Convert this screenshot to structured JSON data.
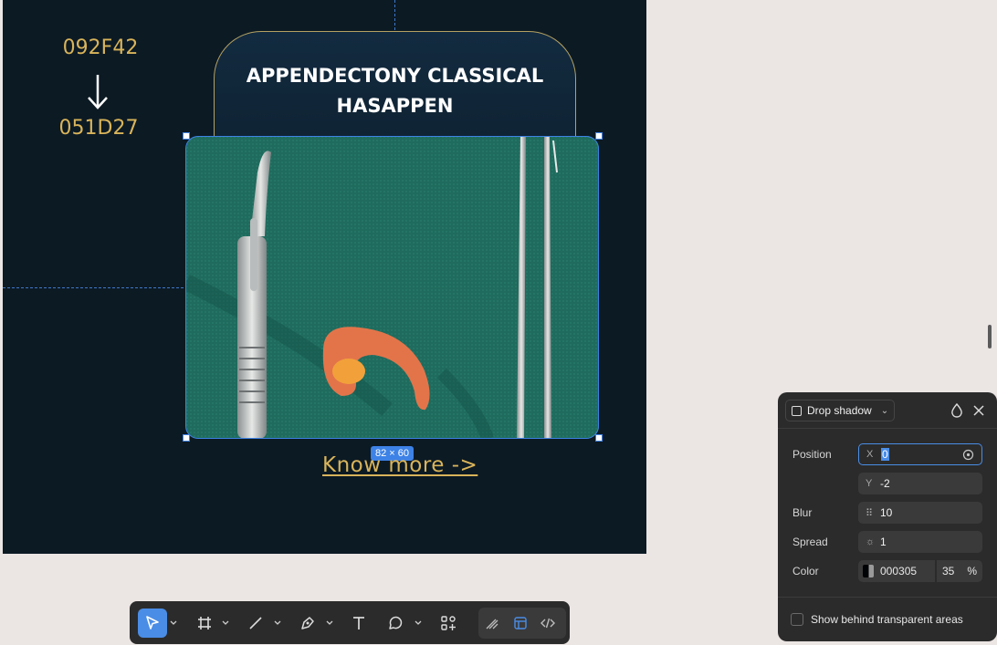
{
  "canvas": {
    "color_from": "092F42",
    "color_to": "051D27",
    "title_lines": [
      "APPENDECTONY CLASSICAL",
      "HASAPPEN"
    ],
    "selection_size": "82 × 60",
    "link_text": "Know more ->",
    "frame_bg": "#0c1a24",
    "accent_gold": "#d9b45a"
  },
  "panel": {
    "type_label": "Drop shadow",
    "icons": [
      "drop-icon",
      "close-icon"
    ],
    "position_label": "Position",
    "x_prefix": "X",
    "x_value": "0",
    "y_prefix": "Y",
    "y_value": "-2",
    "blur_label": "Blur",
    "blur_value": "10",
    "spread_label": "Spread",
    "spread_value": "1",
    "color_label": "Color",
    "color_value": "000305",
    "opacity_value": "35",
    "opacity_unit": "%",
    "checkbox_label": "Show behind transparent areas"
  },
  "toolbar": {
    "tools": [
      "move-tool",
      "frame-tool",
      "line-tool",
      "pen-tool",
      "text-tool",
      "comment-tool",
      "components-tool"
    ],
    "modes": [
      "draw-mode",
      "design-mode",
      "dev-mode"
    ],
    "active_tool": "move-tool",
    "active_mode": "design-mode",
    "accent": "#4a8de6"
  }
}
